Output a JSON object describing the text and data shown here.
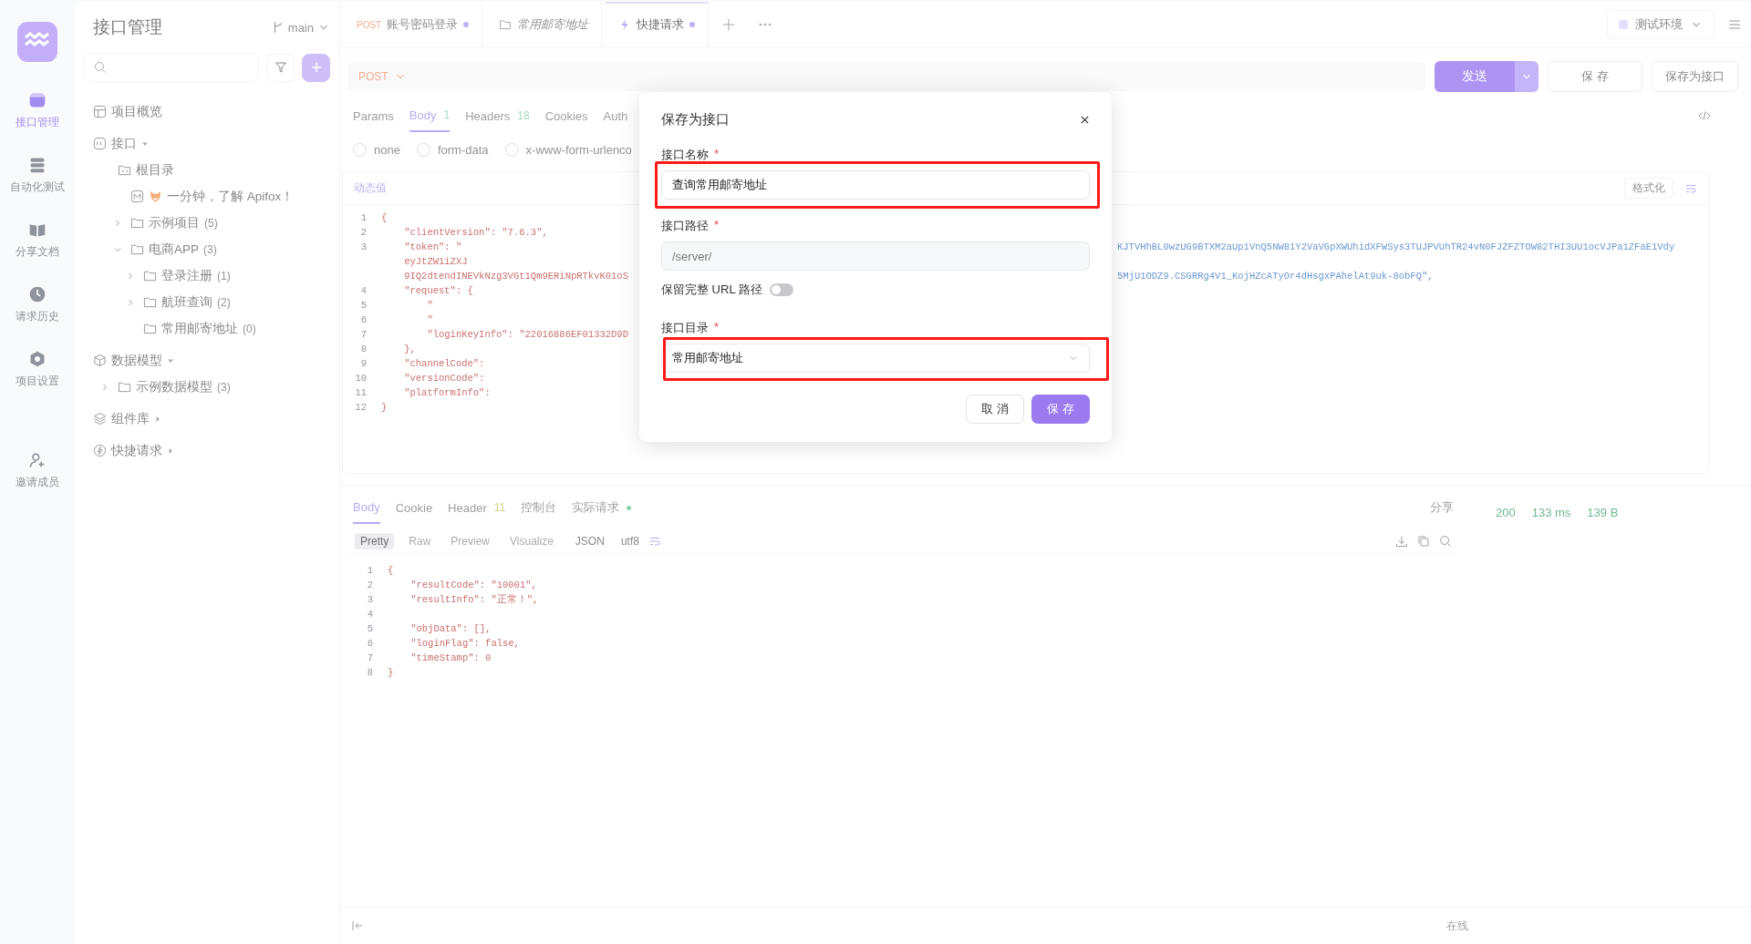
{
  "rail": {
    "items": [
      {
        "label": "接口管理",
        "kind": "api",
        "selected": true
      },
      {
        "label": "自动化测试",
        "kind": "test",
        "selected": false
      },
      {
        "label": "分享文档",
        "kind": "book",
        "selected": false
      },
      {
        "label": "请求历史",
        "kind": "clock",
        "selected": false
      },
      {
        "label": "项目设置",
        "kind": "gear",
        "selected": false
      },
      {
        "label": "邀请成员",
        "kind": "invite",
        "selected": false
      }
    ]
  },
  "project": {
    "title": "接口管理",
    "branch": "main"
  },
  "tree": [
    {
      "label": "项目概览",
      "kind": "overview"
    },
    {
      "label": "接口",
      "kind": "api",
      "expanded": true,
      "children": [
        {
          "label": "根目录",
          "kind": "root",
          "children": [
            {
              "label": "一分钟，了解 Apifox！",
              "kind": "doc"
            },
            {
              "label": "示例项目",
              "count": "(5)",
              "kind": "folder",
              "expanded": false
            },
            {
              "label": "电商APP",
              "count": "(3)",
              "kind": "folder",
              "expanded": true,
              "children": [
                {
                  "label": "登录注册",
                  "count": "(1)",
                  "kind": "folder",
                  "expanded": false
                },
                {
                  "label": "航班查询",
                  "count": "(2)",
                  "kind": "folder",
                  "expanded": false
                },
                {
                  "label": "常用邮寄地址",
                  "count": "(0)",
                  "kind": "folder"
                }
              ]
            }
          ]
        }
      ]
    },
    {
      "label": "数据模型",
      "kind": "model",
      "expanded": true,
      "children": [
        {
          "label": "示例数据模型",
          "count": "(3)",
          "kind": "folder",
          "expanded": false
        }
      ]
    },
    {
      "label": "组件库",
      "kind": "lib",
      "expanded": false
    },
    {
      "label": "快捷请求",
      "kind": "quick",
      "expanded": false
    }
  ],
  "tabs": [
    {
      "method": "POST",
      "label": "账号密码登录",
      "kind": "request",
      "dirty": true,
      "selected": false
    },
    {
      "label": "常用邮寄地址",
      "kind": "folder",
      "dirty": false,
      "selected": false
    },
    {
      "label": "快捷请求",
      "kind": "quick",
      "dirty": true,
      "selected": true
    }
  ],
  "environment": "测试环境",
  "request": {
    "method": "POST",
    "send": "发送",
    "save": "保 存",
    "save_as": "保存为接口"
  },
  "param_tabs": [
    {
      "label": "Params",
      "selected": false
    },
    {
      "label": "Body",
      "count": "1",
      "selected": true
    },
    {
      "label": "Headers",
      "count": "18",
      "selected": false
    },
    {
      "label": "Cookies",
      "selected": false
    },
    {
      "label": "Auth",
      "selected": false
    }
  ],
  "body_types": [
    {
      "label": "none",
      "selected": false
    },
    {
      "label": "form-data",
      "selected": false
    },
    {
      "label": "x-www-form-urlenco",
      "selected": false
    }
  ],
  "editor": {
    "dynamic": "动态值",
    "format": "格式化",
    "lines": [
      {
        "n": "1",
        "text": "{"
      },
      {
        "n": "2",
        "text": "    \"clientVersion\": \"7.6.3\","
      },
      {
        "n": "3",
        "text": "    \"token\": \"",
        "tail": "KJTVHhBL0wzUG9BTXM2aUp1VnQ5NW81Y2VaVGpXWUhidXFWSys3TUJPVUhTR24vN0FJZFZTOW82THI3UU1ocVJPa1ZFaE1Vdy"
      },
      {
        "text": "    eyJtZW1iZXJ"
      },
      {
        "text": "    9IQ2dtendINEVkNzg3VGt1Qm9ERiNpRTkvK01oS",
        "tail": "5MjU1ODZ9.CSGRRg4V1_KojHZcATyOr4dHsgxPAhelAt9uk-8obFQ\","
      },
      {
        "n": "4",
        "text": "    \"request\": {"
      },
      {
        "n": "5",
        "text": "        \""
      },
      {
        "n": "6",
        "text": "        \""
      },
      {
        "n": "7",
        "text": "        \"loginKeyInfo\": \"22016886EF01332D9D"
      },
      {
        "n": "8",
        "text": "    },"
      },
      {
        "n": "9",
        "text": "    \"channelCode\":"
      },
      {
        "n": "10",
        "text": "    \"versionCode\":"
      },
      {
        "n": "11",
        "text": "    \"platformInfo\":"
      },
      {
        "n": "12",
        "text": "}"
      }
    ]
  },
  "modal": {
    "title": "保存为接口",
    "name": {
      "label": "接口名称",
      "mark": "*",
      "value": "查询常用邮寄地址"
    },
    "path": {
      "label": "接口路径",
      "mark": "*",
      "value": "/server/"
    },
    "keep_url": {
      "label": "保留完整 URL 路径",
      "on": false
    },
    "folder": {
      "label": "接口目录",
      "mark": "*",
      "value": "常用邮寄地址"
    },
    "cancel": "取 消",
    "save": "保 存"
  },
  "response": {
    "tabs": [
      {
        "label": "Body",
        "selected": true
      },
      {
        "label": "Cookie",
        "selected": false
      },
      {
        "label": "Header",
        "count": "11",
        "selected": false
      },
      {
        "label": "控制台",
        "selected": false
      },
      {
        "label": "实际请求",
        "dot": true,
        "selected": false
      }
    ],
    "share": "分享",
    "modes": [
      {
        "label": "Pretty",
        "selected": true
      },
      {
        "label": "Raw",
        "selected": false
      },
      {
        "label": "Preview",
        "selected": false
      },
      {
        "label": "Visualize",
        "selected": false
      }
    ],
    "format": "JSON",
    "encoding": "utf8",
    "lines": [
      {
        "n": "1",
        "text": "{"
      },
      {
        "n": "2",
        "text": "    \"resultCode\": \"10001\","
      },
      {
        "n": "3",
        "text": "    \"resultInfo\": \"正常！\","
      },
      {
        "n": "4"
      },
      {
        "n": "5",
        "text": "    \"objData\": [],"
      },
      {
        "n": "6",
        "text": "    \"loginFlag\": false,"
      },
      {
        "n": "7",
        "text": "    \"timeStamp\": 0"
      },
      {
        "n": "8",
        "text": "}"
      }
    ],
    "status": "200",
    "time": "133 ms",
    "size": "139 B"
  },
  "status_bar": {
    "online": "在线"
  }
}
